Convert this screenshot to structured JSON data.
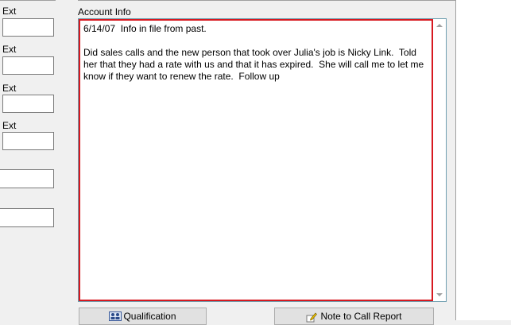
{
  "left": {
    "ext_labels": [
      "Ext",
      "Ext",
      "Ext",
      "Ext"
    ],
    "ext_values": [
      "",
      "",
      "",
      ""
    ],
    "other_values": [
      "",
      ""
    ]
  },
  "account_info": {
    "label": "Account Info",
    "text": "6/14/07  Info in file from past.\n\nDid sales calls and the new person that took over Julia's job is Nicky Link.  Told her that they had a rate with us and that it has expired.  She will call me to let me know if they want to renew the rate.  Follow up"
  },
  "buttons": {
    "qualification": "Qualification",
    "note_to_call_report": "Note to Call Report"
  },
  "icons": {
    "qualification": "people-icon",
    "note_to_call_report": "pencil-note-icon"
  }
}
